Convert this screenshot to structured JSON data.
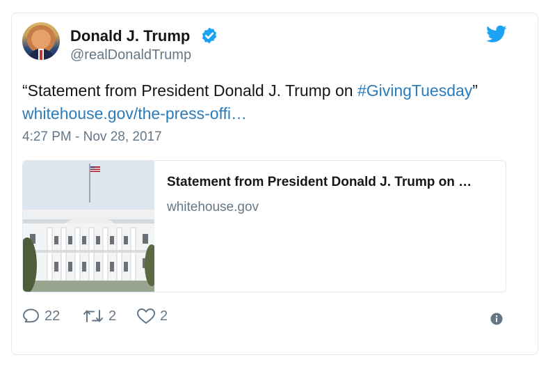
{
  "tweet": {
    "author_name": "Donald J. Trump",
    "handle": "@realDonaldTrump",
    "text_prefix": "“Statement from President Donald J. Trump on ",
    "hashtag": "#GivingTuesday",
    "text_suffix": "”",
    "link": "whitehouse.gov/the-press-offi…",
    "timestamp": "4:27 PM - Nov 28, 2017"
  },
  "card": {
    "title": "Statement from President Donald J. Trump on …",
    "domain": "whitehouse.gov"
  },
  "actions": {
    "replies": "22",
    "retweets": "2",
    "likes": "2"
  },
  "icons": {
    "verified": "verified-badge-icon",
    "brand": "twitter-bird-icon",
    "reply": "reply-icon",
    "retweet": "retweet-icon",
    "like": "heart-icon",
    "info": "info-icon"
  },
  "colors": {
    "brand": "#1da1f2",
    "link": "#2b7bb9",
    "muted": "#657786",
    "text": "#14171a",
    "border": "#e1e8ed"
  }
}
